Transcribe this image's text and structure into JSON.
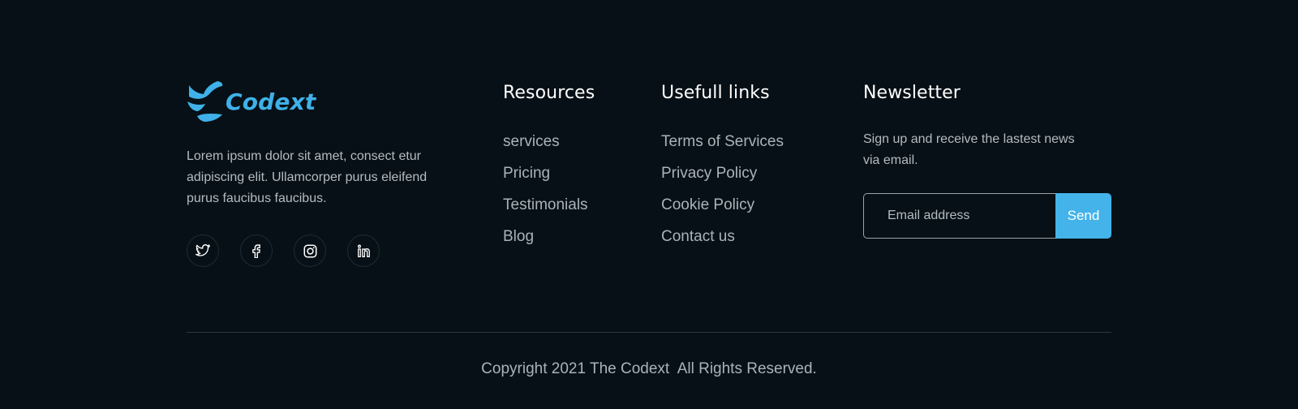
{
  "brand": {
    "name": "Codext",
    "logo_icon": "codext-logo-icon",
    "description": "Lorem ipsum dolor sit amet, consect etur adipiscing elit. Ullamcorper purus eleifend purus faucibus faucibus."
  },
  "socials": [
    {
      "icon": "twitter-icon"
    },
    {
      "icon": "facebook-icon"
    },
    {
      "icon": "instagram-icon"
    },
    {
      "icon": "linkedin-icon"
    }
  ],
  "resources": {
    "title": "Resources",
    "items": [
      "services",
      "Pricing",
      "Testimonials",
      "Blog"
    ]
  },
  "links": {
    "title": "Usefull links",
    "items": [
      "Terms of Services",
      "Privacy Policy",
      "Cookie Policy",
      "Contact us"
    ]
  },
  "newsletter": {
    "title": "Newsletter",
    "text": "Sign up and receive the lastest news via email.",
    "email_placeholder": "Email address",
    "send_label": "Send"
  },
  "copyright": "Copyright 2021 The Codext  All Rights Reserved.",
  "colors": {
    "background": "#071016",
    "accent": "#44b3ea",
    "heading": "#ffffff",
    "text": "#aab3b9"
  }
}
